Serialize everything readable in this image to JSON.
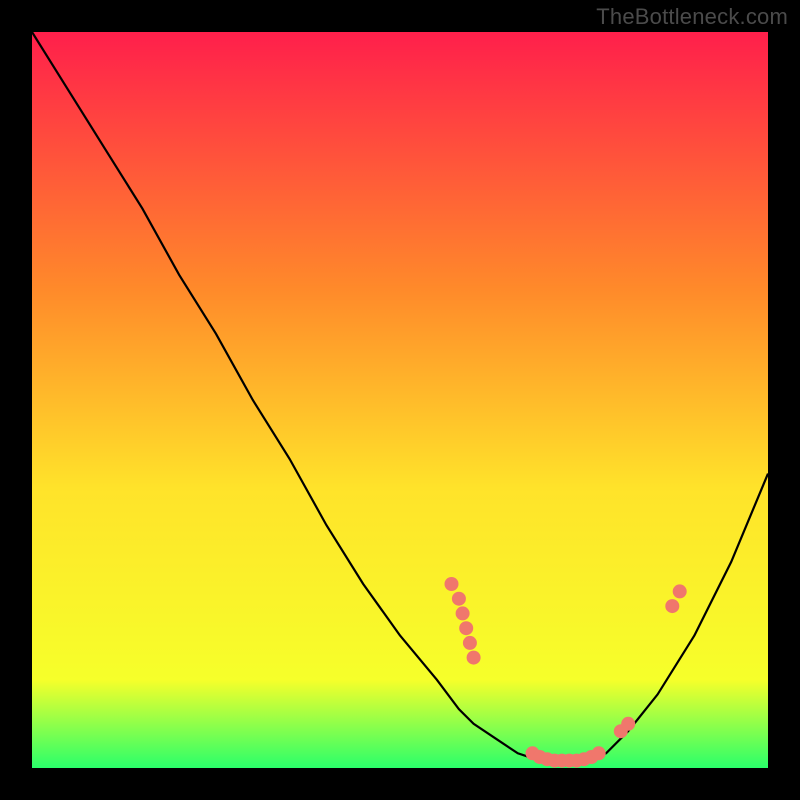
{
  "watermark": "TheBottleneck.com",
  "chart_data": {
    "type": "line",
    "title": "",
    "xlabel": "",
    "ylabel": "",
    "xlim": [
      0,
      100
    ],
    "ylim": [
      0,
      100
    ],
    "background_gradient": {
      "top": "#ff1f4b",
      "mid_upper": "#ff8a2a",
      "mid": "#ffe32a",
      "mid_lower": "#f6ff2a",
      "bottom": "#2aff6a"
    },
    "series": [
      {
        "name": "bottleneck-curve",
        "x": [
          0,
          5,
          10,
          15,
          20,
          25,
          30,
          35,
          40,
          45,
          50,
          55,
          58,
          60,
          63,
          66,
          69,
          72,
          75,
          78,
          81,
          85,
          90,
          95,
          100
        ],
        "y": [
          100,
          92,
          84,
          76,
          67,
          59,
          50,
          42,
          33,
          25,
          18,
          12,
          8,
          6,
          4,
          2,
          1,
          1,
          1,
          2,
          5,
          10,
          18,
          28,
          40
        ],
        "stroke": "#000000"
      }
    ],
    "markers": {
      "name": "highlighted-points",
      "fill": "#f0776c",
      "points": [
        {
          "x": 57,
          "y": 25
        },
        {
          "x": 58,
          "y": 23
        },
        {
          "x": 58.5,
          "y": 21
        },
        {
          "x": 59,
          "y": 19
        },
        {
          "x": 59.5,
          "y": 17
        },
        {
          "x": 60,
          "y": 15
        },
        {
          "x": 68,
          "y": 2
        },
        {
          "x": 69,
          "y": 1.5
        },
        {
          "x": 70,
          "y": 1.2
        },
        {
          "x": 71,
          "y": 1
        },
        {
          "x": 72,
          "y": 1
        },
        {
          "x": 73,
          "y": 1
        },
        {
          "x": 74,
          "y": 1
        },
        {
          "x": 75,
          "y": 1.2
        },
        {
          "x": 76,
          "y": 1.5
        },
        {
          "x": 77,
          "y": 2
        },
        {
          "x": 80,
          "y": 5
        },
        {
          "x": 81,
          "y": 6
        },
        {
          "x": 87,
          "y": 22
        },
        {
          "x": 88,
          "y": 24
        }
      ]
    }
  }
}
